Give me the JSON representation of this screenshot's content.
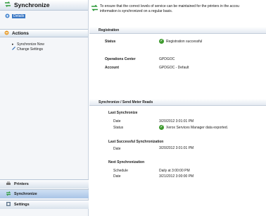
{
  "sidebar": {
    "title": "Synchronize",
    "selected_item": "Details",
    "actions_title": "Actions",
    "actions": [
      "Synchronize Now",
      "Change Settings"
    ],
    "nav": [
      "Printers",
      "Synchronize",
      "Settings"
    ]
  },
  "banner": {
    "line1": "To ensure that the correct levels of service can be maintained for the printers in the accou",
    "line2": "information is synchronized on a regular basis."
  },
  "registration": {
    "title": "Registration",
    "status_label": "Status",
    "status_value": "Registration successful",
    "ops_label": "Operations Center",
    "ops_value": "GPDGOC",
    "account_label": "Account",
    "account_value": "GPDGOC - Default"
  },
  "sync": {
    "title": "Synchronize / Send Meter Reads",
    "last_sync_title": "Last Synchronize",
    "last_sync_date_label": "Date",
    "last_sync_date": "3/20/2012 3:01:01 PM",
    "last_sync_status_label": "Status",
    "last_sync_status": "Xerox Services Manager data exported.",
    "last_success_title": "Last Successful Synchronization",
    "last_success_date_label": "Date",
    "last_success_date": "3/20/2012 3:01:01 PM",
    "next_title": "Next Synchronization",
    "schedule_label": "Schedule",
    "schedule_value": "Daily at 3:00:00 PM",
    "next_date_label": "Date",
    "next_date": "3/21/2012 3:00:00 PM"
  },
  "colors": {
    "accent": "#3b78c4",
    "success": "#3e9a2e",
    "arrow": "#2e9a3a"
  },
  "icons": [
    "sync-arrows-icon",
    "details-icon",
    "actions-icon",
    "triangle-bullet-icon",
    "pencil-icon",
    "printer-icon",
    "sync-icon",
    "settings-icon",
    "check-icon"
  ]
}
